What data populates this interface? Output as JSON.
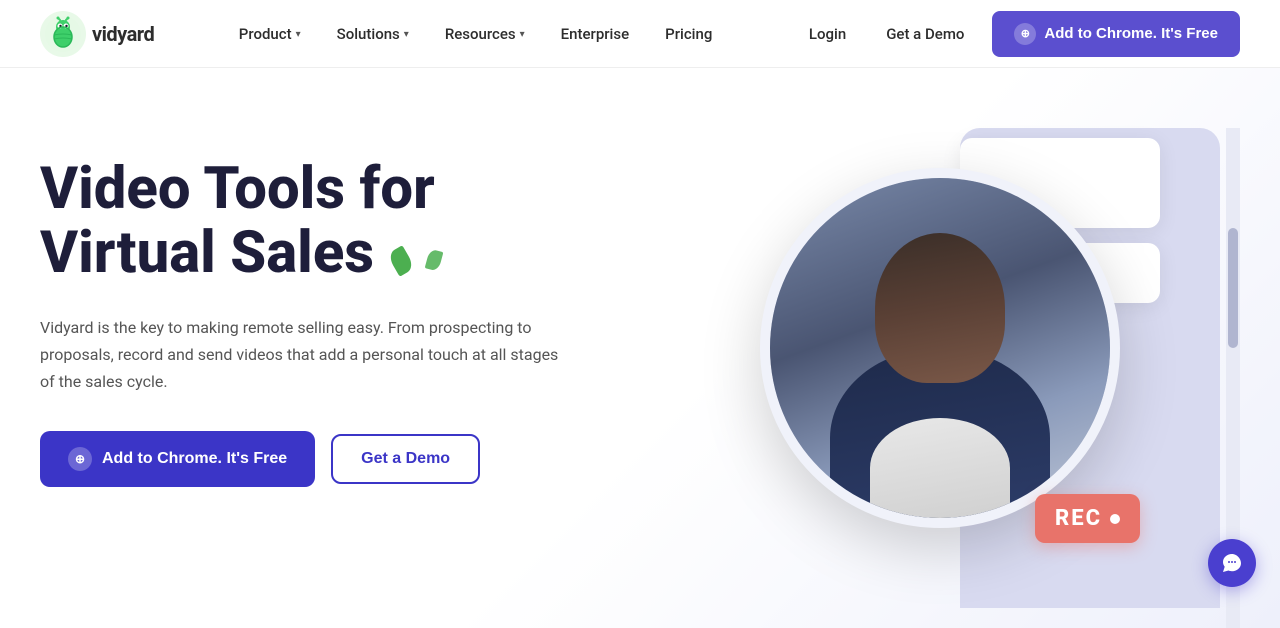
{
  "logo": {
    "icon": "🐛",
    "text": "vidyard"
  },
  "nav": {
    "links": [
      {
        "label": "Product",
        "hasDropdown": true
      },
      {
        "label": "Solutions",
        "hasDropdown": true
      },
      {
        "label": "Resources",
        "hasDropdown": true
      },
      {
        "label": "Enterprise",
        "hasDropdown": false
      },
      {
        "label": "Pricing",
        "hasDropdown": false
      }
    ],
    "login": "Login",
    "demo": "Get a Demo",
    "cta": "Add to Chrome. It's Free"
  },
  "hero": {
    "title_line1": "Video Tools for",
    "title_line2": "Virtual Sales",
    "description": "Vidyard is the key to making remote selling easy. From prospecting to proposals, record and send videos that add a personal touch at all stages of the sales cycle.",
    "cta_primary": "Add to Chrome. It's Free",
    "cta_secondary": "Get a Demo",
    "rec_label": "REC"
  },
  "chat": {
    "icon": "💬"
  }
}
